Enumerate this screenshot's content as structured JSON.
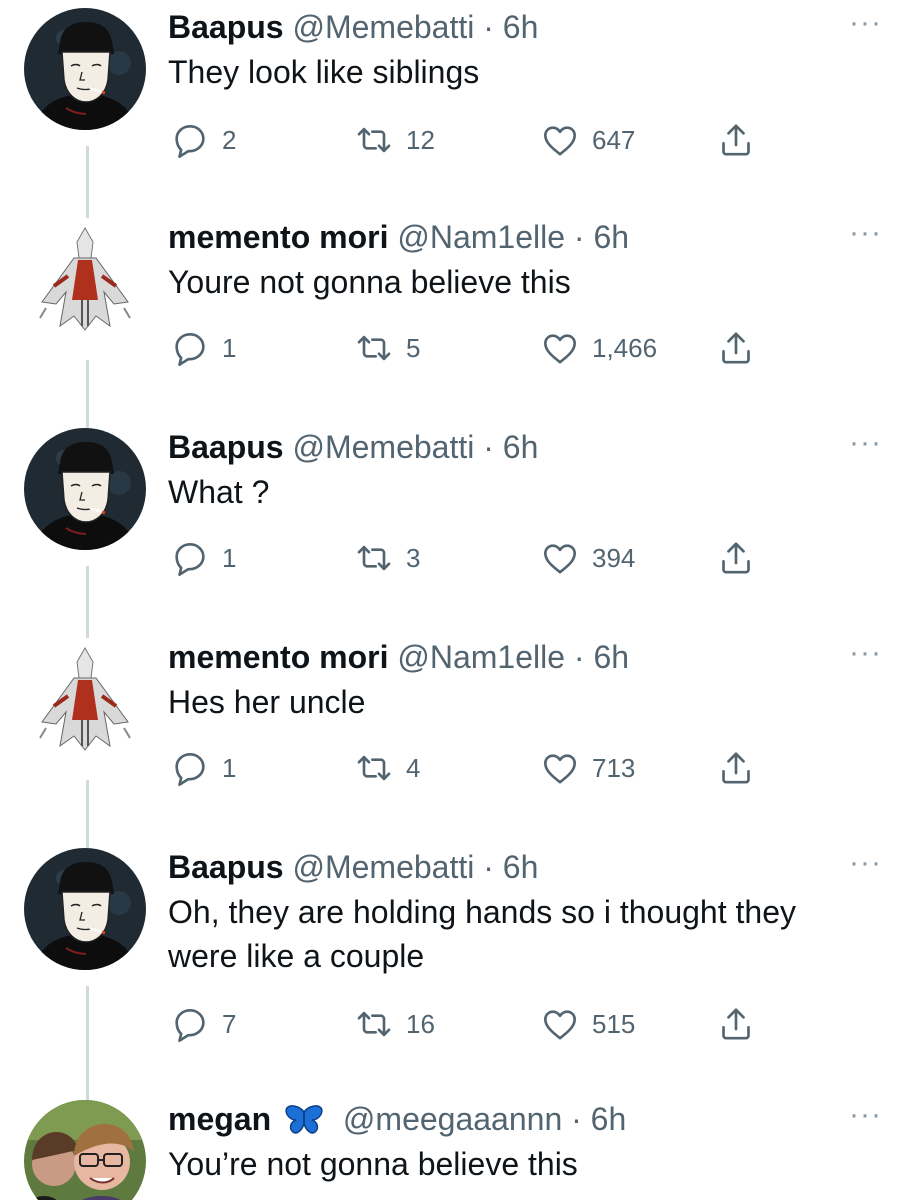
{
  "tweets": [
    {
      "name": "Baapus",
      "handle": "@Memebatti",
      "sep": "·",
      "time": "6h",
      "text": "They look like siblings",
      "replies": "2",
      "retweets": "12",
      "likes": "647",
      "more": "···",
      "avatar": "wojak-avatar"
    },
    {
      "name": "memento mori",
      "handle": "@Nam1elle",
      "sep": "·",
      "time": "6h",
      "text": "Youre not gonna believe this",
      "replies": "1",
      "retweets": "5",
      "likes": "1,466",
      "more": "···",
      "avatar": "assassin-avatar"
    },
    {
      "name": "Baapus",
      "handle": "@Memebatti",
      "sep": "·",
      "time": "6h",
      "text": "What ?",
      "replies": "1",
      "retweets": "3",
      "likes": "394",
      "more": "···",
      "avatar": "wojak-avatar"
    },
    {
      "name": "memento mori",
      "handle": "@Nam1elle",
      "sep": "·",
      "time": "6h",
      "text": "Hes her uncle",
      "replies": "1",
      "retweets": "4",
      "likes": "713",
      "more": "···",
      "avatar": "assassin-avatar"
    },
    {
      "name": "Baapus",
      "handle": "@Memebatti",
      "sep": "·",
      "time": "6h",
      "text_line1": "Oh, they are holding hands so i thought they",
      "text_line2": "were like a couple",
      "replies": "7",
      "retweets": "16",
      "likes": "515",
      "more": "···",
      "avatar": "wojak-avatar"
    },
    {
      "name": "megan",
      "badge": "butterfly-emoji",
      "handle": "@meegaaannn",
      "sep": "·",
      "time": "6h",
      "text": "You’re not gonna believe this",
      "more": "···",
      "avatar": "photo-avatar"
    }
  ],
  "icons": {
    "reply": "reply-icon",
    "retweet": "retweet-icon",
    "like": "heart-icon",
    "share": "share-icon"
  },
  "colors": {
    "text": "#0f1419",
    "secondary": "#536471",
    "thread_line": "#cfd9de",
    "butterfly": "#1d6fd8"
  }
}
